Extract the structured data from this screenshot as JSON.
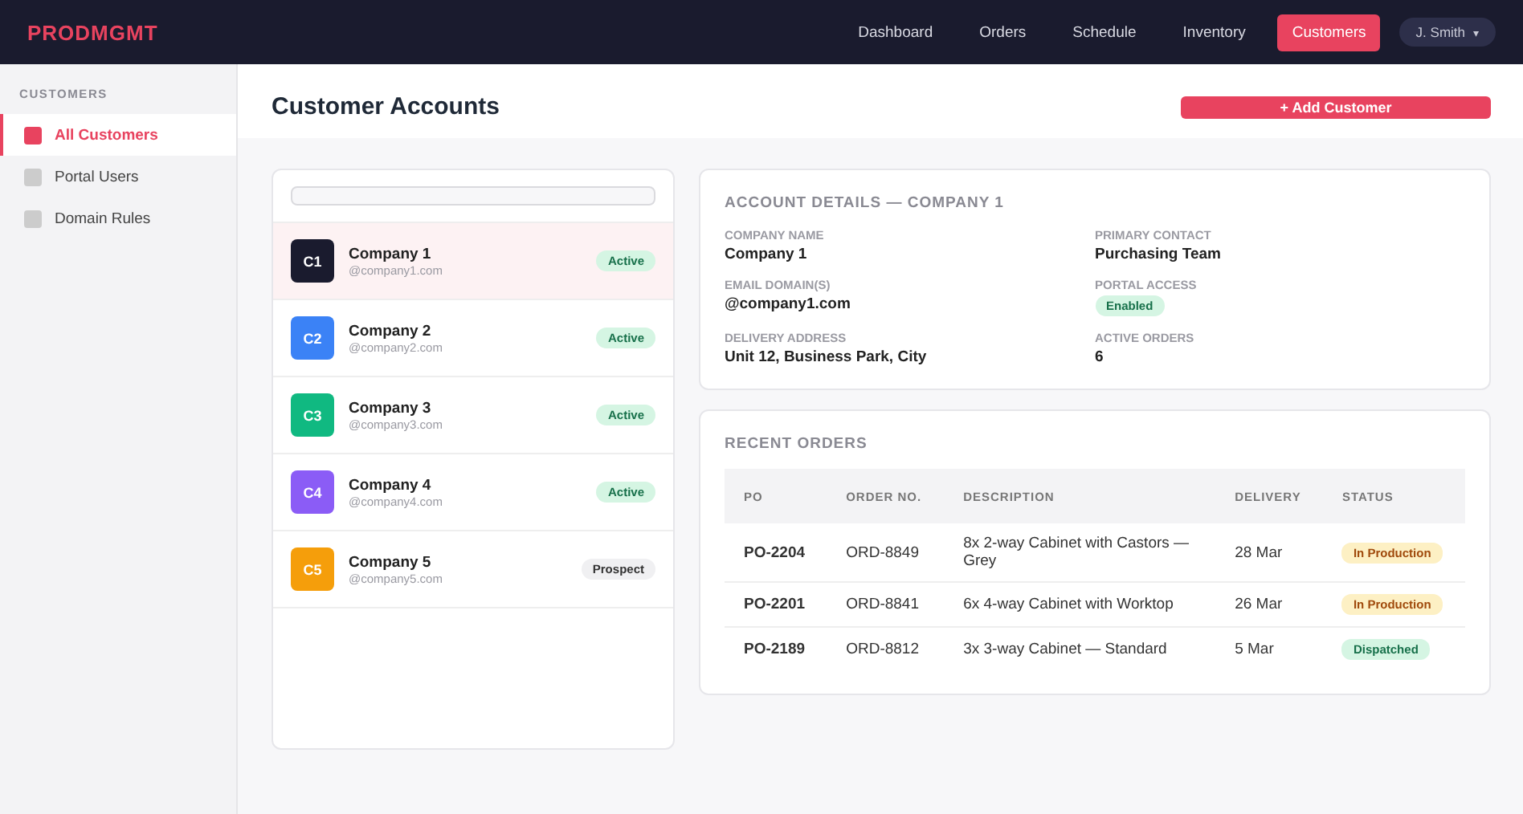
{
  "logo": "PRODMGMT",
  "nav": [
    {
      "label": "Dashboard",
      "selected": false
    },
    {
      "label": "Orders",
      "selected": false
    },
    {
      "label": "Schedule",
      "selected": false
    },
    {
      "label": "Inventory",
      "selected": false
    },
    {
      "label": "Customers",
      "selected": true
    }
  ],
  "user": {
    "name": "J. Smith",
    "caret": "▾"
  },
  "sidebar": {
    "heading": "CUSTOMERS",
    "items": [
      {
        "label": "All Customers",
        "selected": true
      },
      {
        "label": "Portal Users",
        "selected": false
      },
      {
        "label": "Domain Rules",
        "selected": false
      }
    ]
  },
  "page_title": "Customer Accounts",
  "add_button": "+ Add Customer",
  "companies": [
    {
      "initials": "C1",
      "name": "Company 1",
      "domain": "@company1.com",
      "status": "Active",
      "kind": "active",
      "color": "#1a1b2e",
      "selected": true
    },
    {
      "initials": "C2",
      "name": "Company 2",
      "domain": "@company2.com",
      "status": "Active",
      "kind": "active",
      "color": "#3b82f6",
      "selected": false
    },
    {
      "initials": "C3",
      "name": "Company 3",
      "domain": "@company3.com",
      "status": "Active",
      "kind": "active",
      "color": "#10b981",
      "selected": false
    },
    {
      "initials": "C4",
      "name": "Company 4",
      "domain": "@company4.com",
      "status": "Active",
      "kind": "active",
      "color": "#8b5cf6",
      "selected": false
    },
    {
      "initials": "C5",
      "name": "Company 5",
      "domain": "@company5.com",
      "status": "Prospect",
      "kind": "prospect",
      "color": "#f59e0b",
      "selected": false
    }
  ],
  "details": {
    "title": "ACCOUNT DETAILS — COMPANY 1",
    "fields": [
      {
        "label": "COMPANY NAME",
        "value": "Company 1",
        "kind": "text"
      },
      {
        "label": "PRIMARY CONTACT",
        "value": "Purchasing Team",
        "kind": "text"
      },
      {
        "label": "EMAIL DOMAIN(S)",
        "value": "@company1.com",
        "kind": "text"
      },
      {
        "label": "PORTAL ACCESS",
        "value": "Enabled",
        "kind": "badge"
      },
      {
        "label": "DELIVERY ADDRESS",
        "value": "Unit 12, Business Park, City",
        "kind": "text"
      },
      {
        "label": "ACTIVE ORDERS",
        "value": "6",
        "kind": "text"
      }
    ]
  },
  "orders": {
    "title": "RECENT ORDERS",
    "columns": [
      "PO",
      "ORDER NO.",
      "DESCRIPTION",
      "DELIVERY",
      "STATUS"
    ],
    "rows": [
      {
        "po": "PO-2204",
        "order": "ORD-8849",
        "description": "8x 2-way Cabinet with Castors — Grey",
        "delivery": "28 Mar",
        "status": "In Production",
        "kind": "production"
      },
      {
        "po": "PO-2201",
        "order": "ORD-8841",
        "description": "6x 4-way Cabinet with Worktop",
        "delivery": "26 Mar",
        "status": "In Production",
        "kind": "production"
      },
      {
        "po": "PO-2189",
        "order": "ORD-8812",
        "description": "3x 3-way Cabinet — Standard",
        "delivery": "5 Mar",
        "status": "Dispatched",
        "kind": "dispatched"
      }
    ]
  }
}
